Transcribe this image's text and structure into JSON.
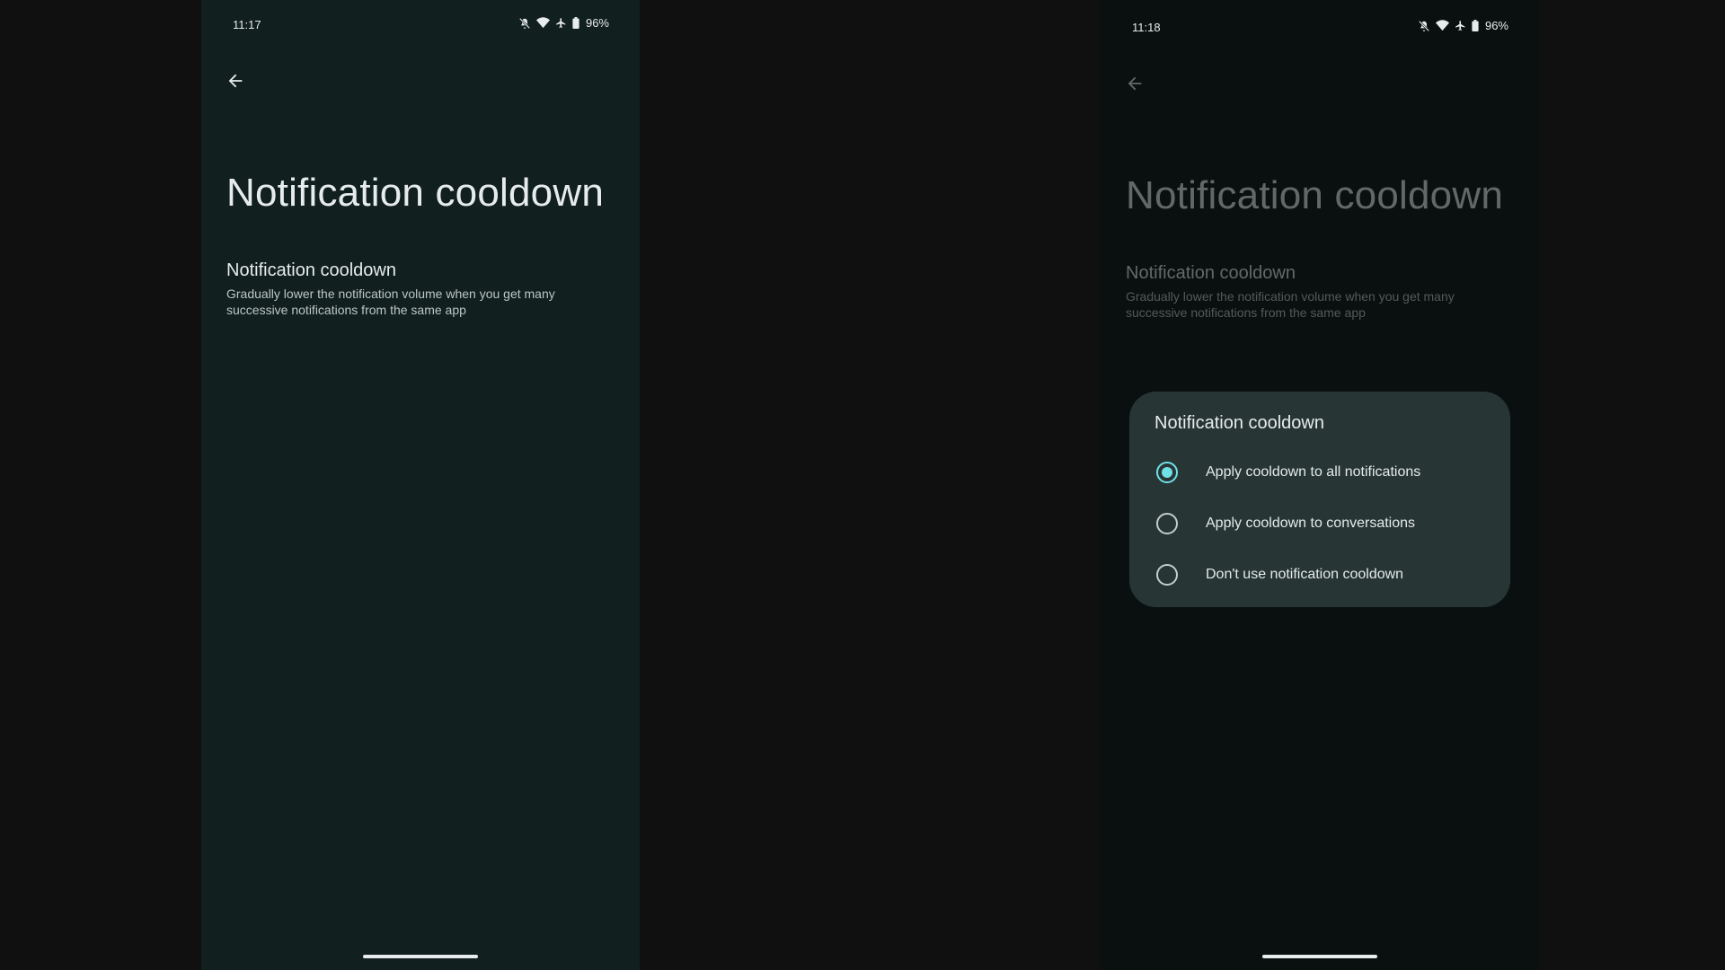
{
  "left_screen": {
    "status": {
      "time": "11:17",
      "battery": "96%"
    },
    "page_title": "Notification cooldown",
    "preference": {
      "title": "Notification cooldown",
      "summary": "Gradually lower the notification volume when you get many successive notifications from the same app"
    }
  },
  "right_screen": {
    "status": {
      "time": "11:18",
      "battery": "96%"
    },
    "page_title": "Notification cooldown",
    "preference": {
      "title": "Notification cooldown",
      "summary": "Gradually lower the notification volume when you get many successive notifications from the same app"
    },
    "dialog": {
      "title": "Notification cooldown",
      "options": [
        {
          "label": "Apply cooldown to all notifications",
          "selected": true
        },
        {
          "label": "Apply cooldown to conversations",
          "selected": false
        },
        {
          "label": "Don't use notification cooldown",
          "selected": false
        }
      ]
    }
  },
  "icons": {
    "status": [
      "mute-icon",
      "wifi-icon",
      "airplane-icon",
      "battery-icon"
    ],
    "navigation": "back-arrow-icon"
  },
  "colors": {
    "left_background": "#121f1f",
    "right_background": "#0a1010",
    "dialog_background": "#273535",
    "accent": "#6fe0e6",
    "outer_background": "#101010"
  }
}
